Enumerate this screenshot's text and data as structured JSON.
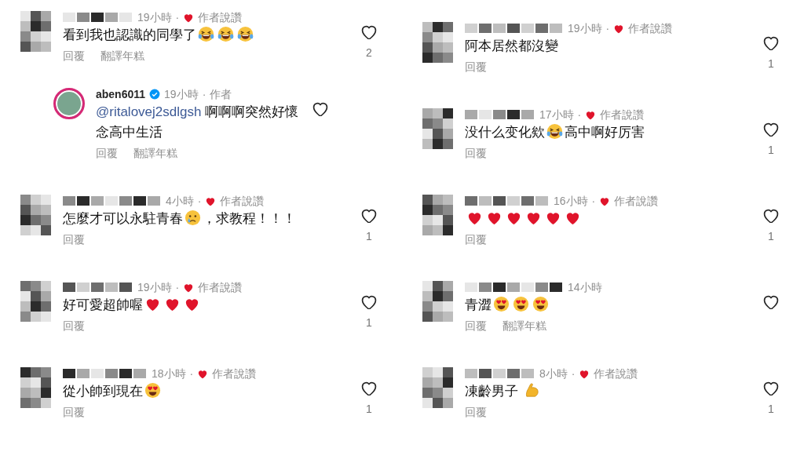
{
  "columns": [
    {
      "comments": [
        {
          "time": "19小時",
          "separator": "·",
          "author_liked": true,
          "badge": "作者說讚",
          "body": [
            {
              "kind": "text",
              "text": "看到我也認識的同學了"
            },
            {
              "kind": "laugh"
            },
            {
              "kind": "laugh"
            },
            {
              "kind": "laugh"
            }
          ],
          "actions": [
            "回覆",
            "翻譯年糕"
          ],
          "likes": "2",
          "replies": [
            {
              "username": "aben6011",
              "verified": true,
              "time": "19小時",
              "separator": "·",
              "author_liked": false,
              "badge": "作者",
              "body": [
                {
                  "kind": "mention",
                  "text": "@ritalovej2sdlgsh"
                },
                {
                  "kind": "text",
                  "text": " 啊啊啊突然好懷念高中生活"
                }
              ],
              "actions": [
                "回覆",
                "翻譯年糕"
              ]
            }
          ]
        },
        {
          "time": "4小時",
          "separator": "·",
          "author_liked": true,
          "badge": "作者說讚",
          "body": [
            {
              "kind": "text",
              "text": "怎麼才可以永駐青春"
            },
            {
              "kind": "cry"
            },
            {
              "kind": "text",
              "text": "，求教程！！！"
            }
          ],
          "actions": [
            "回覆"
          ],
          "likes": "1"
        },
        {
          "time": "19小時",
          "separator": "·",
          "author_liked": true,
          "badge": "作者說讚",
          "body": [
            {
              "kind": "text",
              "text": "好可愛超帥喔"
            },
            {
              "kind": "heart"
            },
            {
              "kind": "heart"
            },
            {
              "kind": "heart"
            }
          ],
          "actions": [
            "回覆"
          ],
          "likes": "1"
        },
        {
          "time": "18小時",
          "separator": "·",
          "author_liked": true,
          "badge": "作者說讚",
          "body": [
            {
              "kind": "text",
              "text": "從小帥到現在"
            },
            {
              "kind": "hearteyes"
            }
          ],
          "actions": [
            "回覆"
          ],
          "likes": "1"
        }
      ]
    },
    {
      "comments": [
        {
          "time": "19小時",
          "separator": "·",
          "author_liked": true,
          "badge": "作者說讚",
          "body": [
            {
              "kind": "text",
              "text": "阿本居然都沒變"
            }
          ],
          "actions": [
            "回覆"
          ],
          "likes": "1"
        },
        {
          "time": "17小時",
          "separator": "·",
          "author_liked": true,
          "badge": "作者說讚",
          "body": [
            {
              "kind": "text",
              "text": "没什么变化欸"
            },
            {
              "kind": "laugh"
            },
            {
              "kind": "text",
              "text": "高中啊好厉害"
            }
          ],
          "actions": [
            "回覆"
          ],
          "likes": "1"
        },
        {
          "time": "16小時",
          "separator": "·",
          "author_liked": true,
          "badge": "作者說讚",
          "body": [
            {
              "kind": "heart"
            },
            {
              "kind": "heart"
            },
            {
              "kind": "heart"
            },
            {
              "kind": "heart"
            },
            {
              "kind": "heart"
            },
            {
              "kind": "heart"
            }
          ],
          "actions": [
            "回覆"
          ],
          "likes": "1"
        },
        {
          "time": "14小時",
          "author_liked": false,
          "body": [
            {
              "kind": "text",
              "text": "青澀"
            },
            {
              "kind": "hearteyes"
            },
            {
              "kind": "hearteyes"
            },
            {
              "kind": "hearteyes"
            }
          ],
          "actions": [
            "回覆",
            "翻譯年糕"
          ]
        },
        {
          "time": "8小時",
          "separator": "·",
          "author_liked": true,
          "badge": "作者說讚",
          "body": [
            {
              "kind": "text",
              "text": "凍齡男子 "
            },
            {
              "kind": "flex"
            }
          ],
          "actions": [
            "回覆"
          ],
          "likes": "1"
        }
      ]
    }
  ]
}
